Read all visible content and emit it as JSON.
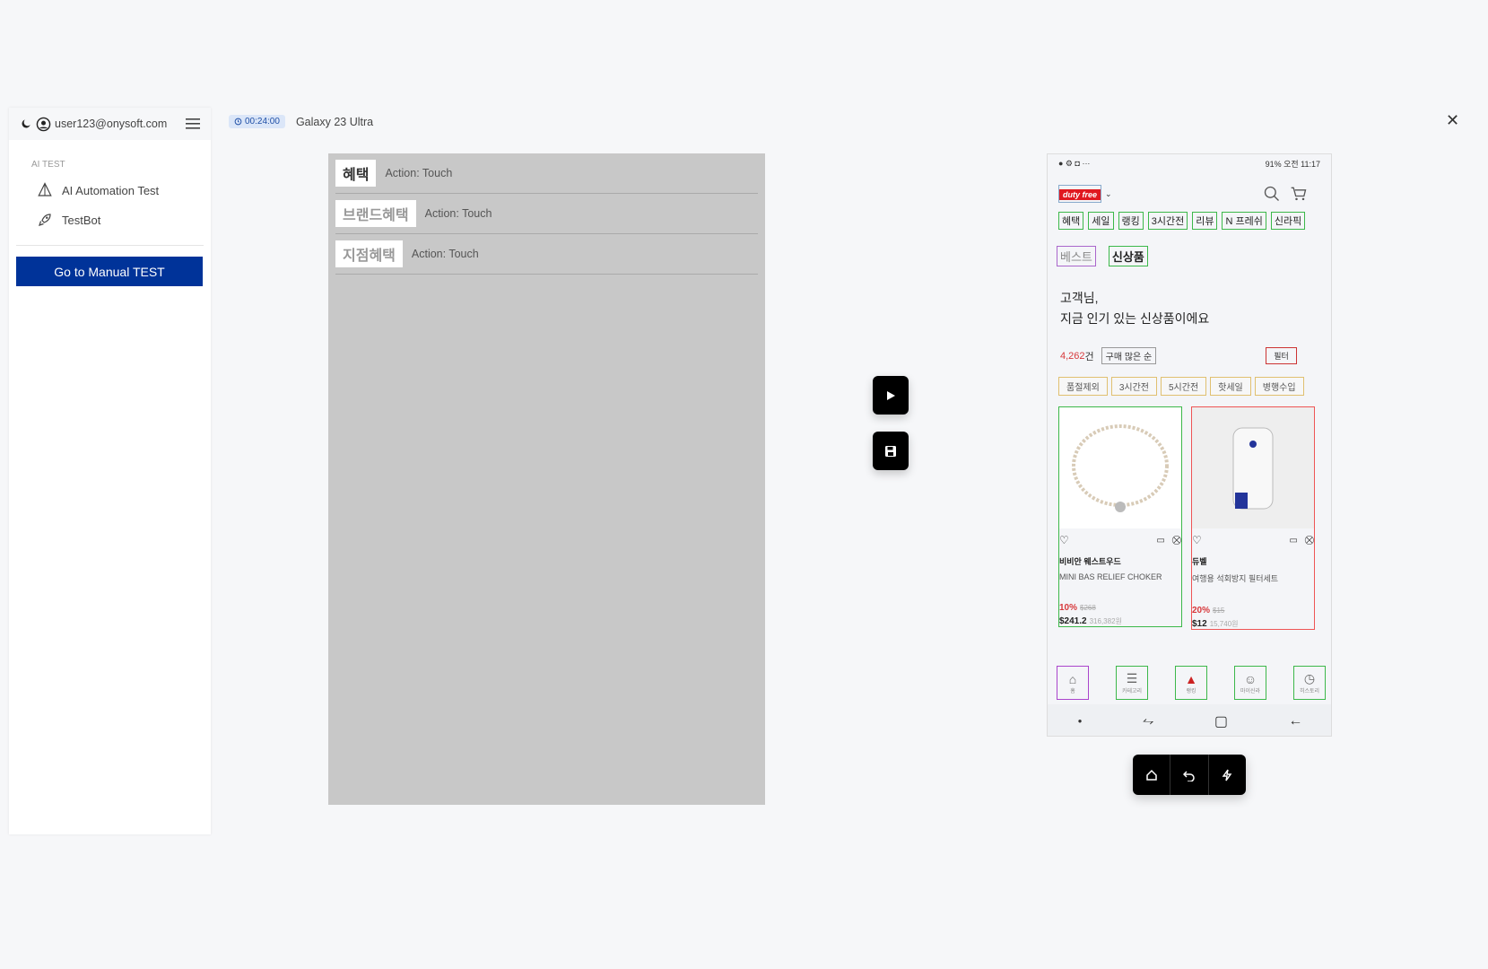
{
  "sidebar": {
    "user_email": "user123@onysoft.com",
    "section_label": "AI TEST",
    "items": [
      {
        "label": "AI Automation Test",
        "icon": "ai-icon"
      },
      {
        "label": "TestBot",
        "icon": "rocket-icon"
      }
    ],
    "manual_button": "Go to Manual TEST"
  },
  "header": {
    "timer": "00:24:00",
    "device": "Galaxy 23 Ultra"
  },
  "steps": [
    {
      "label": "혜택",
      "action": "Action: Touch"
    },
    {
      "label": "브랜드혜택",
      "action": "Action: Touch"
    },
    {
      "label": "지점혜택",
      "action": "Action: Touch"
    }
  ],
  "phone": {
    "status_time": "91% 오전 11:17",
    "logo": "duty free",
    "tabs": [
      "혜택",
      "세일",
      "랭킹",
      "3시간전",
      "리뷰",
      "N 프레쉬",
      "신라픽"
    ],
    "subtabs": [
      "베스트",
      "신상품"
    ],
    "headline_1": "고객님,",
    "headline_2": "지금 인기 있는 신상품이에요",
    "count_num": "4,262",
    "count_unit": "건",
    "sort": "구매 많은 순",
    "filter": "필터",
    "chips": [
      "품절제외",
      "3시간전",
      "5시간전",
      "핫세일",
      "병행수입"
    ],
    "products": [
      {
        "brand": "비비안 웨스트우드",
        "name": "MINI BAS RELIEF CHOKER",
        "discount": "10%",
        "old_price": "$268",
        "price": "$241.2",
        "krw": "316,382원"
      },
      {
        "brand": "듀벨",
        "name": "여행용 석회방지 필터세트",
        "discount": "20%",
        "old_price": "$15",
        "price": "$12",
        "krw": "15,740원"
      }
    ],
    "bottom_nav": [
      "홈",
      "카테고리",
      "랭킹",
      "마이신라",
      "히스토리"
    ]
  },
  "colors": {
    "primary": "#003399",
    "accent_red": "#d7383b",
    "step_bg": "#c8c8c8"
  }
}
